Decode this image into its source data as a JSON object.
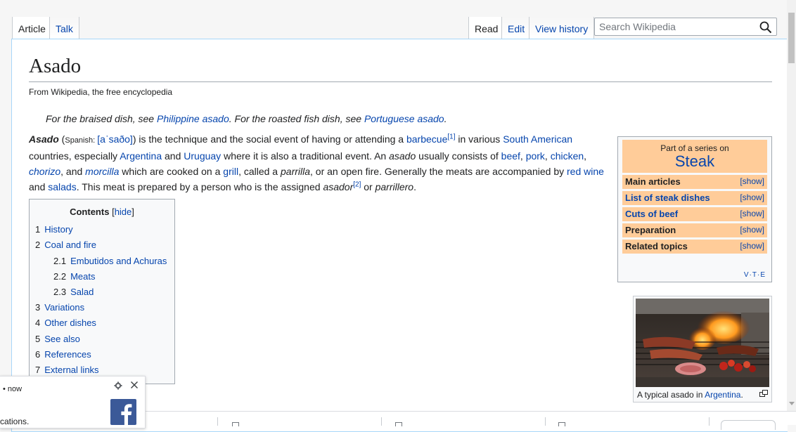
{
  "tabs": {
    "article": "Article",
    "talk": "Talk",
    "read": "Read",
    "edit": "Edit",
    "view_history": "View history"
  },
  "search": {
    "placeholder": "Search Wikipedia"
  },
  "page": {
    "title": "Asado",
    "site_sub": "From Wikipedia, the free encyclopedia"
  },
  "hatnote": {
    "p1": "For the braised dish, see ",
    "l1": "Philippine asado",
    "p2": ". For the roasted fish dish, see ",
    "l2": "Portuguese asado",
    "p3": "."
  },
  "lead": {
    "t_asado": "Asado",
    "t_paren_open": " (",
    "t_spanish": "Spanish: ",
    "l_ipa": "[aˈsaðo]",
    "t_paren_close": ") is the technique and the social event of having or attending a ",
    "l_barbecue": "barbecue",
    "ref1": "[1]",
    "t_in_various": " in various ",
    "l_south_american": "South American",
    "t_countries": " countries, especially ",
    "l_argentina": "Argentina",
    "t_and": " and ",
    "l_uruguay": "Uruguay",
    "t_traditional": " where it is also a traditional event. An ",
    "t_asado_it": "asado",
    "t_consists": " usually consists of ",
    "l_beef": "beef",
    "t_c1": ", ",
    "l_pork": "pork",
    "t_c2": ", ",
    "l_chicken": "chicken",
    "t_c3": ", ",
    "l_chorizo": "chorizo",
    "t_and2": ", and ",
    "l_morcilla": "morcilla",
    "t_cooked": " which are cooked on a ",
    "l_grill": "grill",
    "t_called": ", called a ",
    "t_parrilla": "parrilla",
    "t_openfire": ", or an open fire. Generally the meats are accompanied by ",
    "l_red_wine": "red wine",
    "t_and3": " and ",
    "l_salads": "salads",
    "t_prepared": ". This meat is prepared by a person who is the assigned ",
    "t_asador": "asador",
    "ref2": "[2]",
    "t_or": " or ",
    "t_parrillero": "parrillero",
    "t_end": "."
  },
  "toc": {
    "title": "Contents",
    "toggle_open": "[",
    "toggle": "hide",
    "toggle_close": "]",
    "items": [
      {
        "num": "1",
        "label": "History"
      },
      {
        "num": "2",
        "label": "Coal and fire"
      },
      {
        "num": "2.1",
        "label": "Embutidos and Achuras"
      },
      {
        "num": "2.2",
        "label": "Meats"
      },
      {
        "num": "2.3",
        "label": "Salad"
      },
      {
        "num": "3",
        "label": "Variations"
      },
      {
        "num": "4",
        "label": "Other dishes"
      },
      {
        "num": "5",
        "label": "See also"
      },
      {
        "num": "6",
        "label": "References"
      },
      {
        "num": "7",
        "label": "External links"
      }
    ]
  },
  "navbox": {
    "pre": "Part of a series on",
    "title": "Steak",
    "rows": [
      {
        "label": "Main articles",
        "show": "[show]"
      },
      {
        "label": "List of steak dishes",
        "show": "[show]"
      },
      {
        "label": "Cuts of beef",
        "show": "[show]"
      },
      {
        "label": "Preparation",
        "show": "[show]"
      },
      {
        "label": "Related topics",
        "show": "[show]"
      }
    ],
    "vte": "V·T·E"
  },
  "thumb": {
    "caption_pre": "A typical asado in ",
    "caption_link": "Argentina",
    "caption_post": "."
  },
  "notification": {
    "time": "• now",
    "text": "cations."
  },
  "colors": {
    "link": "#0645ad",
    "navbox_bg": "#ffcc99",
    "content_border": "#a7d7f9",
    "facebook": "#3b5998"
  }
}
